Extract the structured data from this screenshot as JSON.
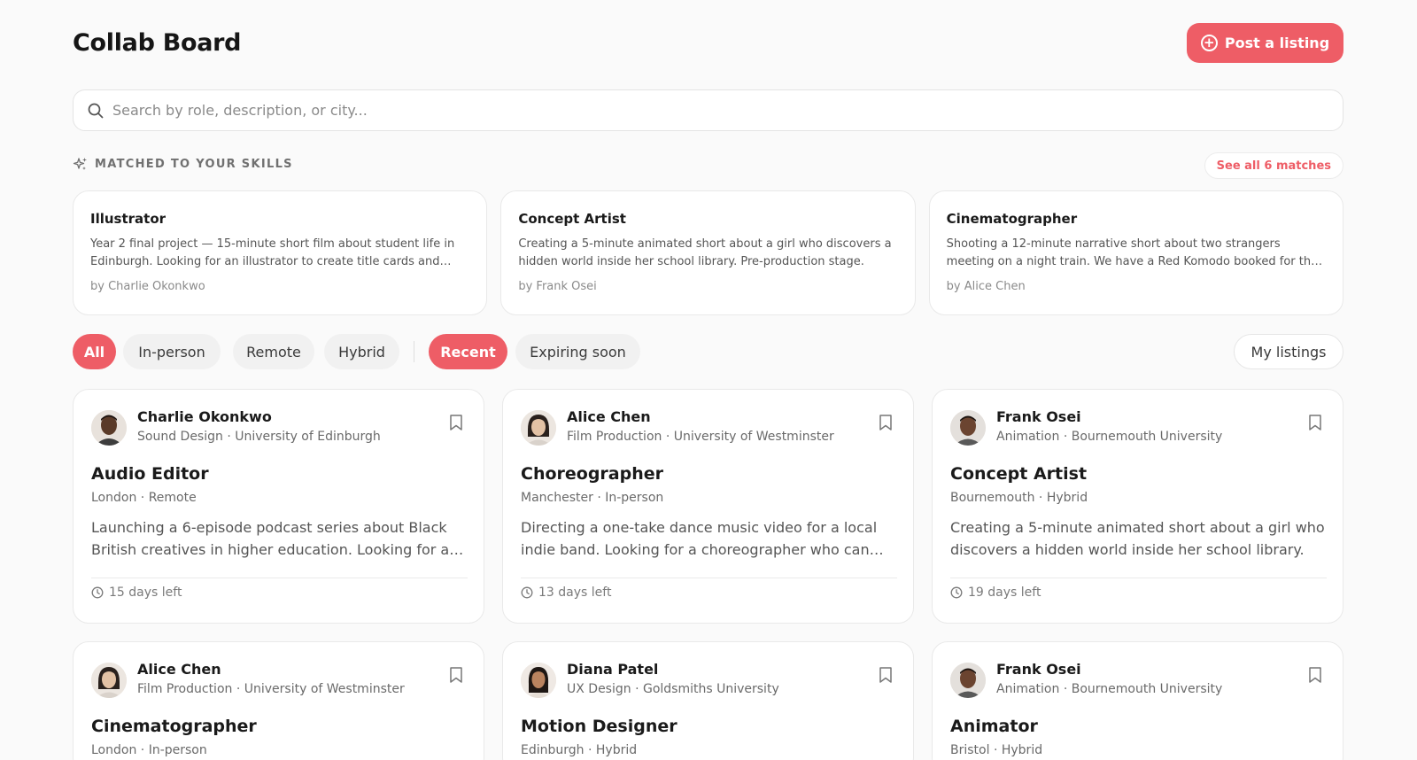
{
  "header": {
    "title": "Collab Board",
    "post_button": "Post a listing"
  },
  "search": {
    "placeholder": "Search by role, description, or city..."
  },
  "matched": {
    "label": "MATCHED TO YOUR SKILLS",
    "see_all": "See all 6 matches",
    "cards": [
      {
        "role": "Illustrator",
        "description": "Year 2 final project — 15-minute short film about student life in Edinburgh. Looking for an illustrator to create title cards and animated sequences.",
        "by": "by Charlie Okonkwo"
      },
      {
        "role": "Concept Artist",
        "description": "Creating a 5-minute animated short about a girl who discovers a hidden world inside her school library. Pre-production stage.",
        "by": "by Frank Osei"
      },
      {
        "role": "Cinematographer",
        "description": "Shooting a 12-minute narrative short about two strangers meeting on a night train. We have a Red Komodo booked for the shoot.",
        "by": "by Alice Chen"
      }
    ]
  },
  "filters": {
    "location": [
      "All",
      "In-person",
      "Remote",
      "Hybrid"
    ],
    "sort": [
      "Recent",
      "Expiring soon"
    ],
    "active_location": "All",
    "active_sort": "Recent",
    "my_listings": "My listings"
  },
  "listings": [
    {
      "author": "Charlie Okonkwo",
      "discipline": "Sound Design",
      "university": "University of Edinburgh",
      "role": "Audio Editor",
      "city": "London",
      "mode": "Remote",
      "description": "Launching a 6-episode podcast series about Black British creatives in higher education. Looking for an audio editor.",
      "deadline": "15 days left",
      "avatar": "man-dark"
    },
    {
      "author": "Alice Chen",
      "discipline": "Film Production",
      "university": "University of Westminster",
      "role": "Choreographer",
      "city": "Manchester",
      "mode": "In-person",
      "description": "Directing a one-take dance music video for a local indie band. Looking for a choreographer who can work with non-dancers.",
      "deadline": "13 days left",
      "avatar": "woman-east-asian"
    },
    {
      "author": "Frank Osei",
      "discipline": "Animation",
      "university": "Bournemouth University",
      "role": "Concept Artist",
      "city": "Bournemouth",
      "mode": "Hybrid",
      "description": "Creating a 5-minute animated short about a girl who discovers a hidden world inside her school library.",
      "deadline": "19 days left",
      "avatar": "man-dark"
    },
    {
      "author": "Alice Chen",
      "discipline": "Film Production",
      "university": "University of Westminster",
      "role": "Cinematographer",
      "city": "London",
      "mode": "In-person",
      "description": "",
      "deadline": "",
      "avatar": "woman-east-asian"
    },
    {
      "author": "Diana Patel",
      "discipline": "UX Design",
      "university": "Goldsmiths University",
      "role": "Motion Designer",
      "city": "Edinburgh",
      "mode": "Hybrid",
      "description": "",
      "deadline": "",
      "avatar": "woman-south-asian"
    },
    {
      "author": "Frank Osei",
      "discipline": "Animation",
      "university": "Bournemouth University",
      "role": "Animator",
      "city": "Bristol",
      "mode": "Hybrid",
      "description": "",
      "deadline": "",
      "avatar": "man-dark"
    }
  ],
  "colors": {
    "accent": "#ee5d66",
    "background": "#fafafa",
    "card": "#ffffff",
    "chip": "#f1f1f1",
    "muted_text": "#6a6a6a"
  }
}
